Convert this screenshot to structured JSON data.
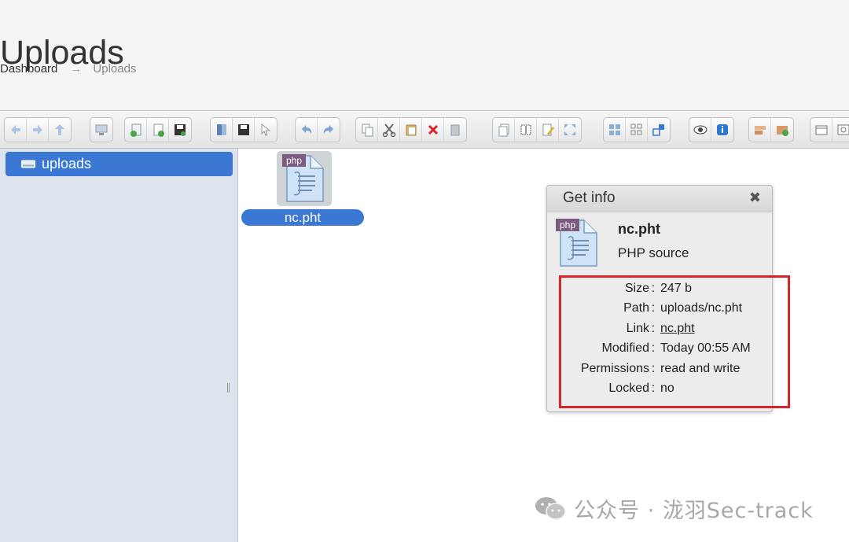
{
  "page": {
    "title": "Uploads",
    "breadcrumb": {
      "home": "Dashboard",
      "separator": "→",
      "current": "Uploads"
    }
  },
  "toolbar": {
    "icons": [
      [
        "back-icon",
        "forward-icon",
        "up-icon"
      ],
      [
        "netmount-icon"
      ],
      [
        "upload-icon",
        "new-file-icon",
        "save-icon"
      ],
      [
        "open-icon",
        "download-icon",
        "select-icon"
      ],
      [
        "undo-icon",
        "redo-icon"
      ],
      [
        "copy-icon",
        "cut-icon",
        "paste-icon",
        "delete-icon",
        "empty-icon"
      ],
      [
        "duplicate-icon",
        "rename-icon",
        "edit-icon",
        "resize-icon"
      ],
      [
        "view-icons-icon",
        "view-list-icon",
        "select-all-icon"
      ],
      [
        "preview-icon",
        "info-icon"
      ],
      [
        "extract-icon",
        "archive-icon"
      ],
      [
        "places-icon",
        "search-icon"
      ]
    ]
  },
  "sidebar": {
    "root_label": "uploads"
  },
  "files": [
    {
      "name": "nc.pht",
      "badge": "php"
    }
  ],
  "dialog": {
    "title": "Get info",
    "close": "✖",
    "badge": "php",
    "filename": "nc.pht",
    "kind": "PHP source",
    "rows": [
      {
        "key": "Size",
        "value": "247 b"
      },
      {
        "key": "Path",
        "value": "uploads/nc.pht"
      },
      {
        "key": "Link",
        "value": "nc.pht"
      },
      {
        "key": "Modified",
        "value": "Today 00:55 AM"
      },
      {
        "key": "Permissions",
        "value": "read and write"
      },
      {
        "key": "Locked",
        "value": "no"
      }
    ],
    "separator": ":"
  },
  "watermark": {
    "text": "公众号 · 泷羽Sec-track"
  },
  "colors": {
    "selection": "#3a78d4",
    "highlight": "#d9252a",
    "sidebar": "#dde4ee"
  }
}
